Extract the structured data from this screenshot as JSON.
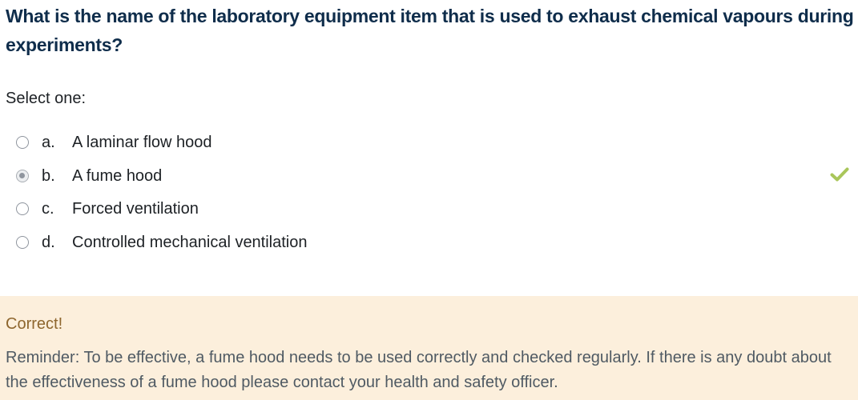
{
  "question": {
    "text": "What is the name of the laboratory equipment item that is used to exhaust chemical vapours during experiments?"
  },
  "prompt": "Select one:",
  "answers": [
    {
      "letter": "a.",
      "text": "A laminar flow hood",
      "selected": false
    },
    {
      "letter": "b.",
      "text": "A fume hood",
      "selected": true,
      "icon": "check-icon"
    },
    {
      "letter": "c.",
      "text": "Forced ventilation",
      "selected": false
    },
    {
      "letter": "d.",
      "text": "Controlled mechanical ventilation",
      "selected": false
    }
  ],
  "feedback": {
    "status": "Correct!",
    "reminder": "Reminder:  To be effective, a fume hood needs to be used correctly and checked regularly. If there is any doubt about the effectiveness of a fume hood please contact your health and safety officer."
  },
  "colors": {
    "question_text": "#0f2d4b",
    "check": "#a9c65a",
    "feedback_bg": "#fcefdc",
    "correct_text": "#8e662e"
  }
}
